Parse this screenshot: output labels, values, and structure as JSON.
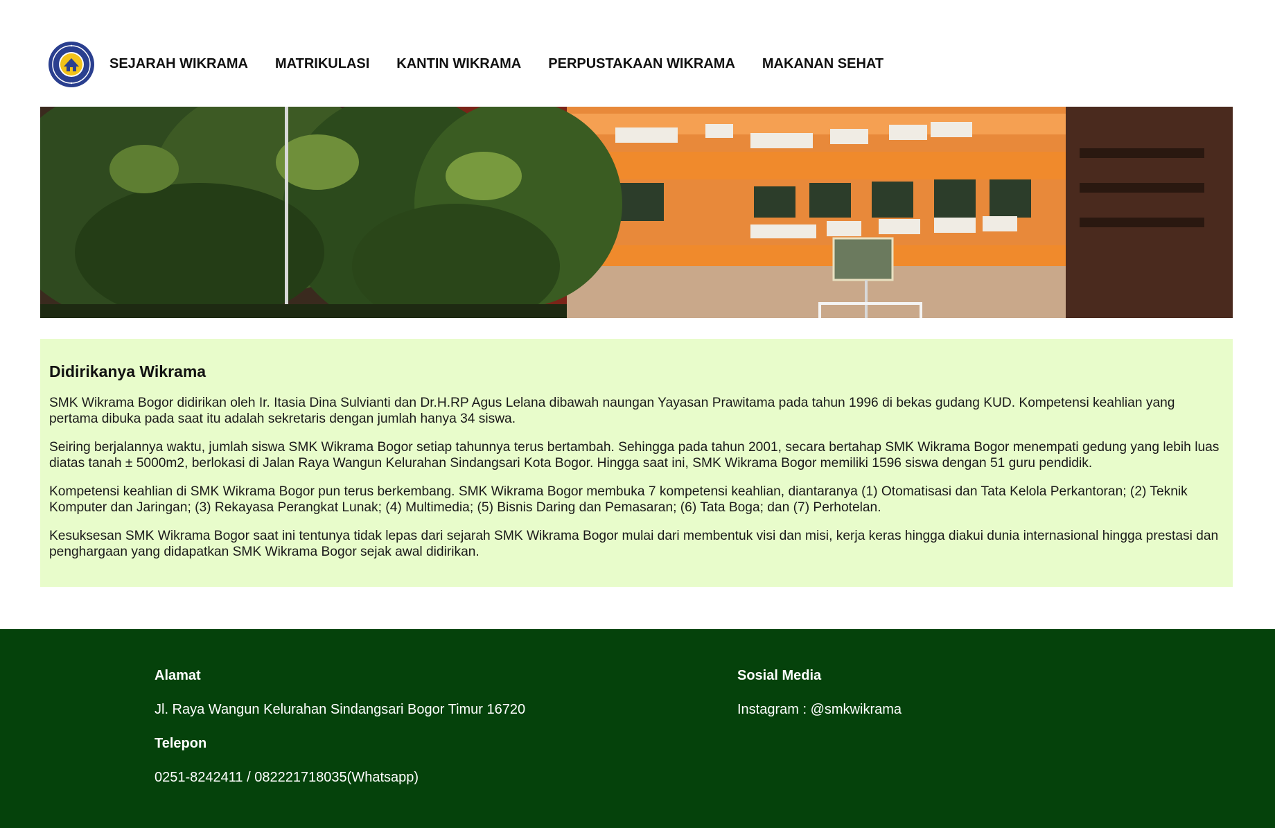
{
  "colors": {
    "content_bg": "#e8fccb",
    "footer_bg": "#05420b",
    "logo_blue": "#2a3f8f",
    "logo_yellow": "#f2c21a"
  },
  "header": {
    "logo_icon": "school-logo-icon",
    "nav": [
      {
        "label": "SEJARAH WIKRAMA"
      },
      {
        "label": "MATRIKULASI"
      },
      {
        "label": "KANTIN WIKRAMA"
      },
      {
        "label": "PERPUSTAKAAN WIKRAMA"
      },
      {
        "label": "MAKANAN SEHAT"
      }
    ]
  },
  "hero": {
    "image": "school-building-photo"
  },
  "main": {
    "title": "Didirikanya Wikrama",
    "paragraphs": [
      "SMK Wikrama Bogor didirikan oleh Ir. Itasia Dina Sulvianti dan Dr.H.RP Agus Lelana dibawah naungan Yayasan Prawitama pada tahun 1996 di bekas gudang KUD. Kompetensi keahlian yang pertama dibuka pada saat itu adalah sekretaris dengan jumlah hanya 34 siswa.",
      "Seiring berjalannya waktu, jumlah siswa SMK Wikrama Bogor setiap tahunnya terus bertambah. Sehingga pada tahun 2001, secara bertahap SMK Wikrama Bogor menempati gedung yang lebih luas diatas tanah ± 5000m2, berlokasi di Jalan Raya Wangun Kelurahan Sindangsari Kota Bogor. Hingga saat ini, SMK Wikrama Bogor memiliki 1596 siswa dengan 51 guru pendidik.",
      "Kompetensi keahlian di SMK Wikrama Bogor pun terus berkembang. SMK Wikrama Bogor membuka 7 kompetensi keahlian, diantaranya (1) Otomatisasi dan Tata Kelola Perkantoran; (2) Teknik Komputer dan Jaringan; (3) Rekayasa Perangkat Lunak; (4) Multimedia; (5) Bisnis Daring dan Pemasaran; (6) Tata Boga; dan (7) Perhotelan.",
      "Kesuksesan SMK Wikrama Bogor saat ini tentunya tidak lepas dari sejarah SMK Wikrama Bogor mulai dari membentuk visi dan misi, kerja keras hingga diakui dunia internasional hingga prestasi dan penghargaan yang didapatkan SMK Wikrama Bogor sejak awal didirikan."
    ]
  },
  "footer": {
    "address_heading": "Alamat",
    "address": "Jl. Raya Wangun Kelurahan Sindangsari Bogor Timur 16720",
    "phone_heading": "Telepon",
    "phone": "0251-8242411 / 082221718035(Whatsapp)",
    "social_heading": "Sosial Media",
    "instagram": "Instagram : @smkwikrama"
  }
}
